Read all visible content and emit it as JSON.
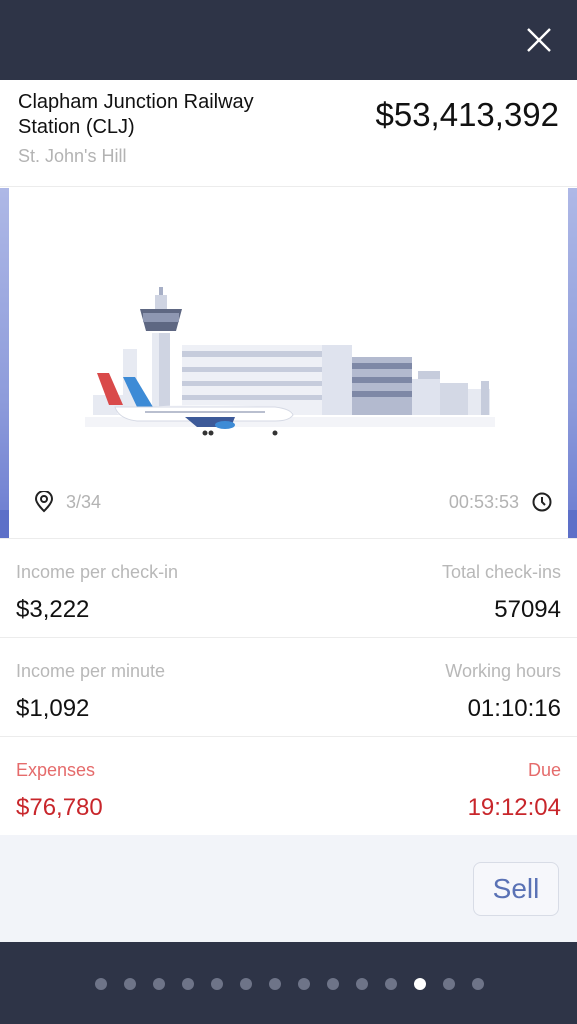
{
  "station": {
    "name": "Clapham Junction Railway Station (CLJ)",
    "street": "St. John's Hill",
    "price": "$53,413,392"
  },
  "illustration": {
    "position": "3/34",
    "timer": "00:53:53"
  },
  "stats": {
    "income_per_checkin_label": "Income per check-in",
    "income_per_checkin": "$3,222",
    "total_checkins_label": "Total check-ins",
    "total_checkins": "57094",
    "income_per_minute_label": "Income per minute",
    "income_per_minute": "$1,092",
    "working_hours_label": "Working hours",
    "working_hours": "01:10:16",
    "expenses_label": "Expenses",
    "expenses": "$76,780",
    "due_label": "Due",
    "due": "19:12:04"
  },
  "actions": {
    "sell_label": "Sell"
  },
  "pager": {
    "total": 14,
    "active_index": 11
  },
  "colors": {
    "accent": "#5a72b5",
    "danger": "#c8262b",
    "overlay": "#2e3447"
  }
}
